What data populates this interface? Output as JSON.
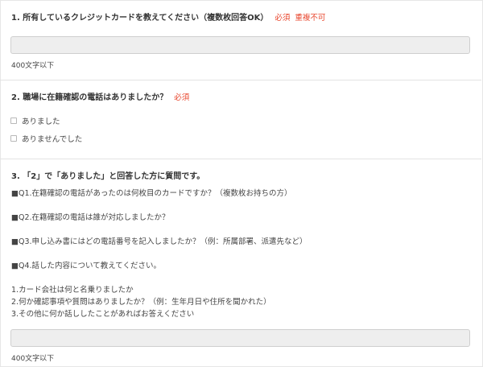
{
  "q1": {
    "title": "1. 所有しているクレジットカードを教えてください（複数枚回答OK）",
    "required": "必須",
    "no_duplicate": "重複不可",
    "value": "",
    "limit": "400文字以下"
  },
  "q2": {
    "title": "2. 職場に在籍確認の電話はありましたか？",
    "required": "必須",
    "options": [
      "ありました",
      "ありませんでした"
    ]
  },
  "q3": {
    "title": "3. 「2」で「ありました」と回答した方に質問です。",
    "sub": [
      "■Q1.在籍確認の電話があったのは何枚目のカードですか？（複数枚お持ちの方）",
      "■Q2.在籍確認の電話は誰が対応しましたか？",
      "■Q3.申し込み書にはどの電話番号を記入しましたか？（例：所属部署、派遣先など）",
      "■Q4.話した内容について教えてください。"
    ],
    "notes": [
      "1.カード会社は何と名乗りましたか",
      "2.何か確認事項や質問はありましたか？（例：生年月日や住所を聞かれた）",
      "3.その他に何か話ししたことがあればお答えください"
    ],
    "value": "",
    "limit": "400文字以下"
  }
}
